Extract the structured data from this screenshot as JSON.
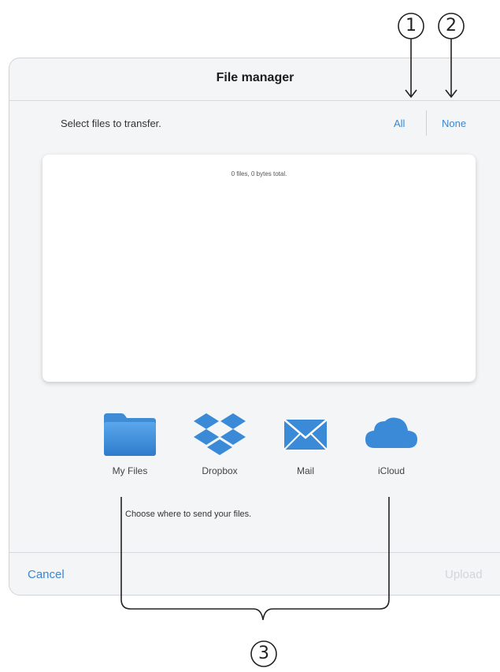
{
  "dialog": {
    "title": "File manager",
    "instruction": "Select files to transfer.",
    "select_all_label": "All",
    "select_none_label": "None",
    "file_summary": "0 files, 0 bytes total.",
    "destination_hint": "Choose where to send your files.",
    "cancel_label": "Cancel",
    "upload_label": "Upload"
  },
  "destinations": [
    {
      "label": "My Files",
      "icon": "folder-icon"
    },
    {
      "label": "Dropbox",
      "icon": "dropbox-icon"
    },
    {
      "label": "Mail",
      "icon": "mail-icon"
    },
    {
      "label": "iCloud",
      "icon": "cloud-icon"
    }
  ],
  "callouts": [
    "1",
    "2",
    "3"
  ],
  "colors": {
    "accent": "#3d86cf",
    "icon_blue": "#3a8ad8",
    "disabled": "#d2d5d9",
    "dialog_bg": "#f4f5f6"
  }
}
